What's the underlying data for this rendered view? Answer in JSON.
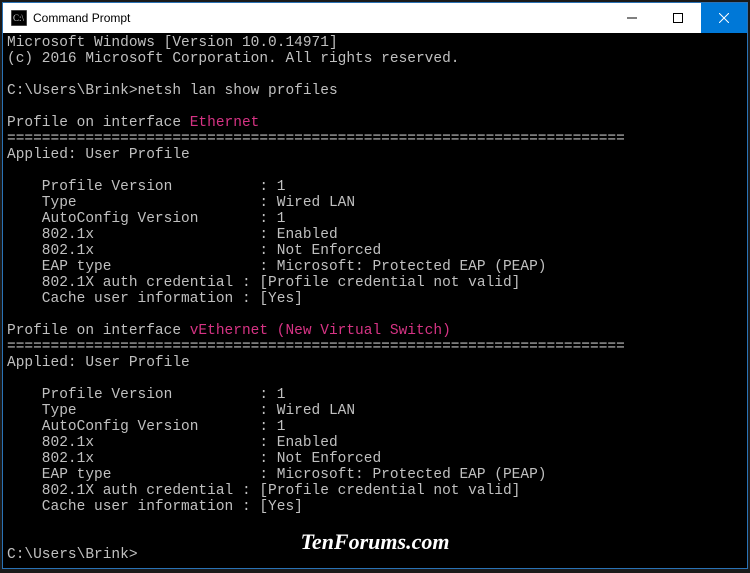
{
  "window": {
    "title": "Command Prompt",
    "icon": "cmd-icon"
  },
  "terminal": {
    "banner1": "Microsoft Windows [Version 10.0.14971]",
    "banner2": "(c) 2016 Microsoft Corporation. All rights reserved.",
    "prompt_path": "C:\\Users\\Brink>",
    "command": "netsh lan show profiles",
    "hr": "=======================================================================",
    "profiles": [
      {
        "header_prefix": "Profile on interface ",
        "interface_name": "Ethernet",
        "applied": "Applied: User Profile",
        "fields": {
          "ProfileVersion": "    Profile Version          : 1",
          "Type": "    Type                     : Wired LAN",
          "AutoConfig": "    AutoConfig Version       : 1",
          "Dot1x_1": "    802.1x                   : Enabled",
          "Dot1x_2": "    802.1x                   : Not Enforced",
          "EAP": "    EAP type                 : Microsoft: Protected EAP (PEAP)",
          "AuthCred": "    802.1X auth credential : [Profile credential not valid]",
          "CacheUser": "    Cache user information : [Yes]"
        }
      },
      {
        "header_prefix": "Profile on interface ",
        "interface_name": "vEthernet (New Virtual Switch)",
        "applied": "Applied: User Profile",
        "fields": {
          "ProfileVersion": "    Profile Version          : 1",
          "Type": "    Type                     : Wired LAN",
          "AutoConfig": "    AutoConfig Version       : 1",
          "Dot1x_1": "    802.1x                   : Enabled",
          "Dot1x_2": "    802.1x                   : Not Enforced",
          "EAP": "    EAP type                 : Microsoft: Protected EAP (PEAP)",
          "AuthCred": "    802.1X auth credential : [Profile credential not valid]",
          "CacheUser": "    Cache user information : [Yes]"
        }
      }
    ]
  },
  "watermark": "TenForums.com"
}
